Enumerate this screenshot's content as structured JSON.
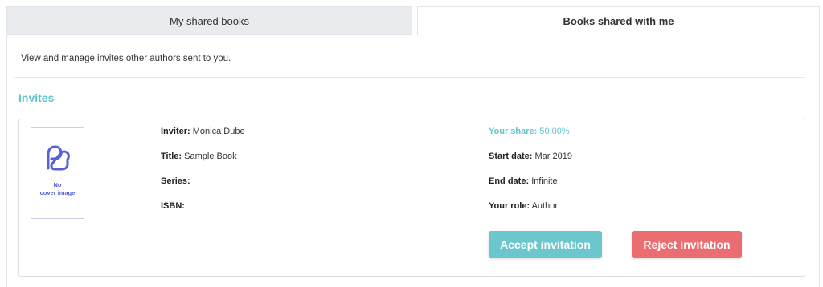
{
  "tabs": [
    {
      "label": "My shared books",
      "active": false
    },
    {
      "label": "Books shared with me",
      "active": true
    }
  ],
  "description": "View and manage invites other authors sent to you.",
  "section_title": "Invites",
  "invite": {
    "cover": {
      "icon": "book-logo-icon",
      "line1": "No",
      "line2": "cover image"
    },
    "inviter": {
      "label": "Inviter:",
      "value": "Monica Dube"
    },
    "title": {
      "label": "Title:",
      "value": "Sample Book"
    },
    "series": {
      "label": "Series:",
      "value": ""
    },
    "isbn": {
      "label": "ISBN:",
      "value": ""
    },
    "share": {
      "label": "Your share:",
      "value": "50.00%"
    },
    "start_date": {
      "label": "Start date:",
      "value": "Mar 2019"
    },
    "end_date": {
      "label": "End date:",
      "value": "Infinite"
    },
    "role": {
      "label": "Your role:",
      "value": "Author"
    },
    "accept_label": "Accept invitation",
    "reject_label": "Reject invitation"
  },
  "colors": {
    "accent": "#5fc5cf",
    "accept": "#6cc7cd",
    "reject": "#ea6d72",
    "cover_icon": "#5661d8"
  }
}
